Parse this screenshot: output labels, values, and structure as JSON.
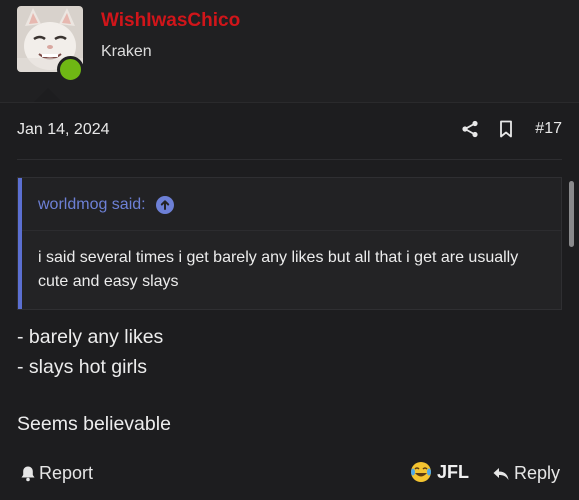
{
  "user": {
    "username": "WishIwasChico",
    "title": "Kraken",
    "status": "online",
    "username_color": "#d0151a",
    "status_color": "#6fb714"
  },
  "post": {
    "date": "Jan 14, 2024",
    "number": "#17",
    "quote": {
      "author_label": "worldmog said:",
      "text": "i said several times i get barely any likes but all that i get are usually cute and easy slays"
    },
    "body_lines": [
      "- barely any likes",
      "- slays hot girls",
      "Seems believable"
    ]
  },
  "icons": {
    "share": "share-icon",
    "bookmark": "bookmark-icon",
    "quote_jump": "arrow-up-circle-icon",
    "report": "bell-icon",
    "reaction": "crying-laughing-emoji",
    "reply": "reply-arrow-icon"
  },
  "footer": {
    "report_label": "Report",
    "reaction_label": "JFL",
    "reply_label": "Reply"
  },
  "colors": {
    "background": "#1d1d1f",
    "accent": "#6d80d6"
  }
}
